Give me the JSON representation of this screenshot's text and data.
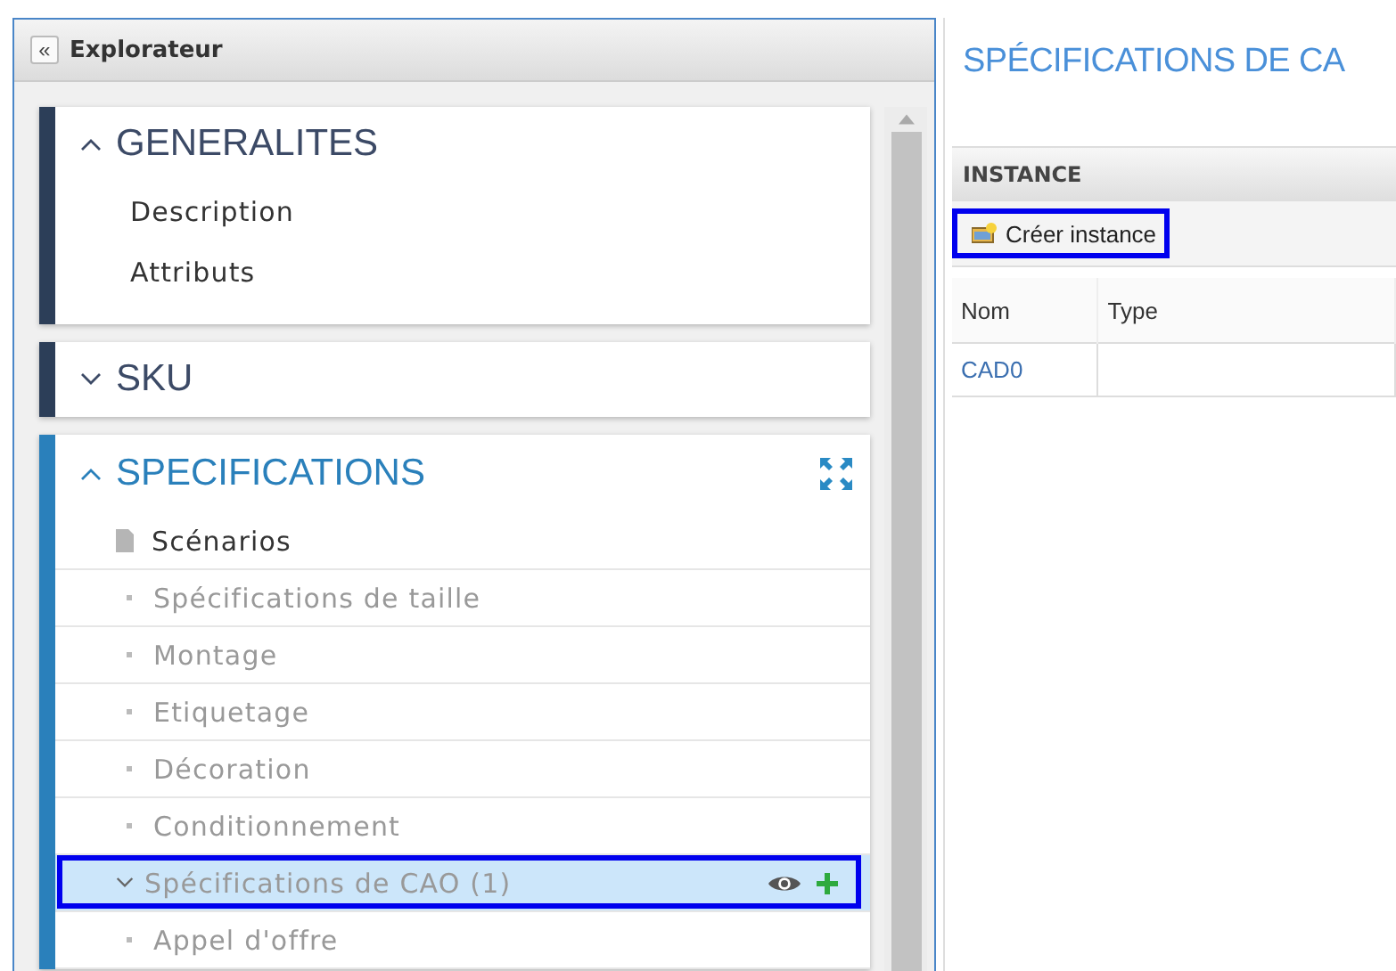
{
  "explorer": {
    "title": "Explorateur",
    "collapse_icon": "«",
    "sections": [
      {
        "title": "GENERALITES",
        "expanded": true,
        "selected": false,
        "items": [
          {
            "kind": "link",
            "label": "Description"
          },
          {
            "kind": "link",
            "label": "Attributs"
          }
        ]
      },
      {
        "title": "SKU",
        "expanded": false,
        "selected": false
      },
      {
        "title": "SPECIFICATIONS",
        "expanded": true,
        "selected": true,
        "items": [
          {
            "kind": "document",
            "label": "Scénarios",
            "selected": false
          },
          {
            "kind": "bullet",
            "label": "Spécifications de taille",
            "selected": false
          },
          {
            "kind": "bullet",
            "label": "Montage",
            "selected": false
          },
          {
            "kind": "bullet",
            "label": "Etiquetage",
            "selected": false
          },
          {
            "kind": "bullet",
            "label": "Décoration",
            "selected": false
          },
          {
            "kind": "bullet",
            "label": "Conditionnement",
            "selected": false
          },
          {
            "kind": "group",
            "label": "Spécifications de CAO (1)",
            "expanded": false,
            "selected": true
          },
          {
            "kind": "bullet",
            "label": "Appel d'offre",
            "selected": false
          }
        ]
      }
    ]
  },
  "detail": {
    "title": "SPÉCIFICATIONS DE CA",
    "panel_title": "INSTANCE",
    "create_button": "Créer instance",
    "table": {
      "columns": [
        "Nom",
        "Type"
      ],
      "rows": [
        [
          "CAD0",
          ""
        ]
      ]
    }
  }
}
